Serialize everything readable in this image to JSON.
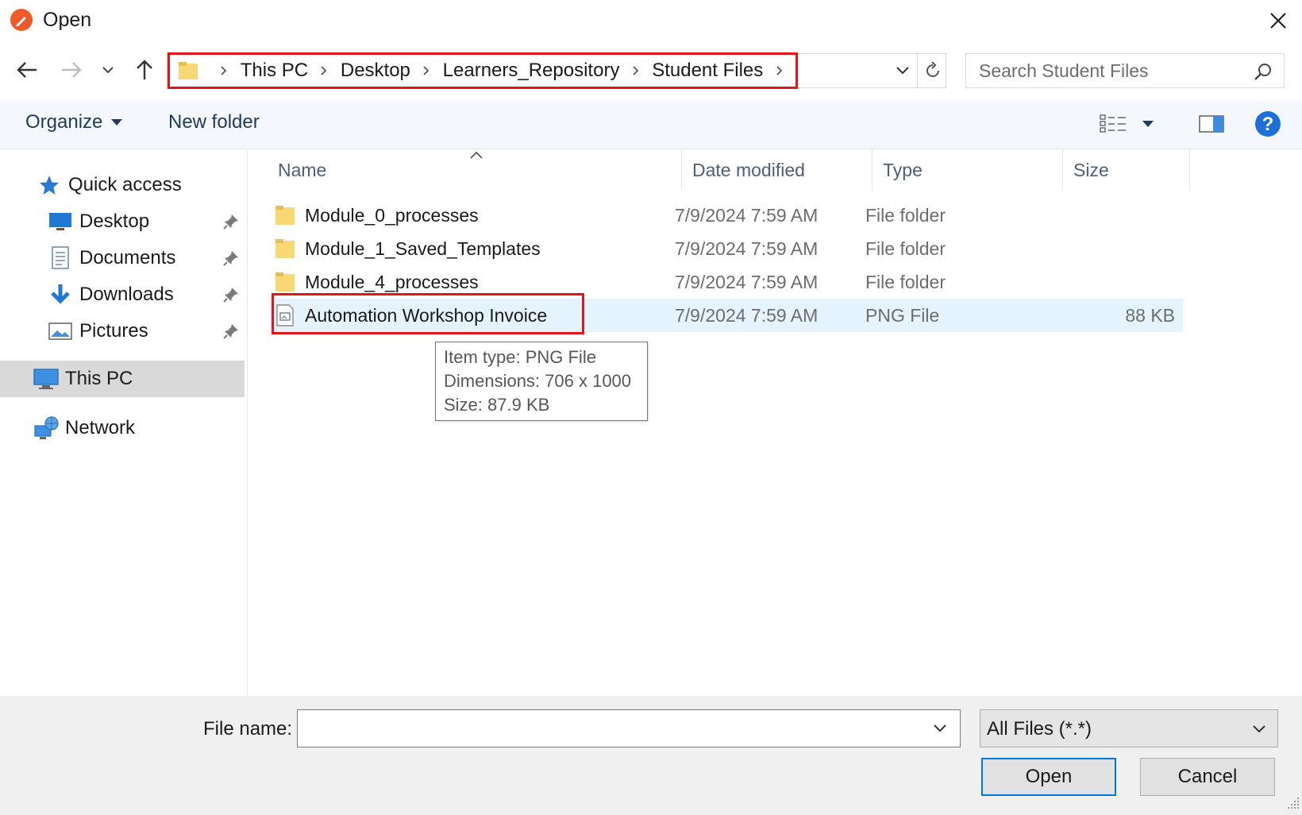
{
  "window": {
    "title": "Open"
  },
  "address": {
    "crumbs": [
      "This PC",
      "Desktop",
      "Learners_Repository",
      "Student Files"
    ]
  },
  "search": {
    "placeholder": "Search Student Files"
  },
  "toolbar": {
    "organize_label": "Organize",
    "new_folder_label": "New folder"
  },
  "sidebar": {
    "items": [
      {
        "label": "Quick access",
        "icon": "star-icon"
      },
      {
        "label": "Desktop",
        "icon": "desktop-icon",
        "pinned": true
      },
      {
        "label": "Documents",
        "icon": "documents-icon",
        "pinned": true
      },
      {
        "label": "Downloads",
        "icon": "downloads-icon",
        "pinned": true
      },
      {
        "label": "Pictures",
        "icon": "pictures-icon",
        "pinned": true
      },
      {
        "label": "This PC",
        "icon": "computer-icon",
        "selected": true
      },
      {
        "label": "Network",
        "icon": "network-icon"
      }
    ]
  },
  "columns": {
    "name": "Name",
    "date": "Date modified",
    "type": "Type",
    "size": "Size"
  },
  "files": [
    {
      "name": "Module_0_processes",
      "date": "7/9/2024 7:59 AM",
      "type": "File folder",
      "size": "",
      "icon": "folder-icon"
    },
    {
      "name": "Module_1_Saved_Templates",
      "date": "7/9/2024 7:59 AM",
      "type": "File folder",
      "size": "",
      "icon": "folder-icon"
    },
    {
      "name": "Module_4_processes",
      "date": "7/9/2024 7:59 AM",
      "type": "File folder",
      "size": "",
      "icon": "folder-icon"
    },
    {
      "name": "Automation Workshop Invoice",
      "date": "7/9/2024 7:59 AM",
      "type": "PNG File",
      "size": "88 KB",
      "icon": "image-file-icon"
    }
  ],
  "tooltip": {
    "line1": "Item type: PNG File",
    "line2": "Dimensions: 706 x 1000",
    "line3": "Size: 87.9 KB"
  },
  "bottom": {
    "file_name_label": "File name:",
    "file_name_value": "",
    "filter_value": "All Files (*.*)",
    "open_label": "Open",
    "cancel_label": "Cancel"
  },
  "colors": {
    "highlight": "#e0161b",
    "accent": "#0078d7",
    "hover_row": "#e5f3ff",
    "folder": "#f8d775"
  }
}
